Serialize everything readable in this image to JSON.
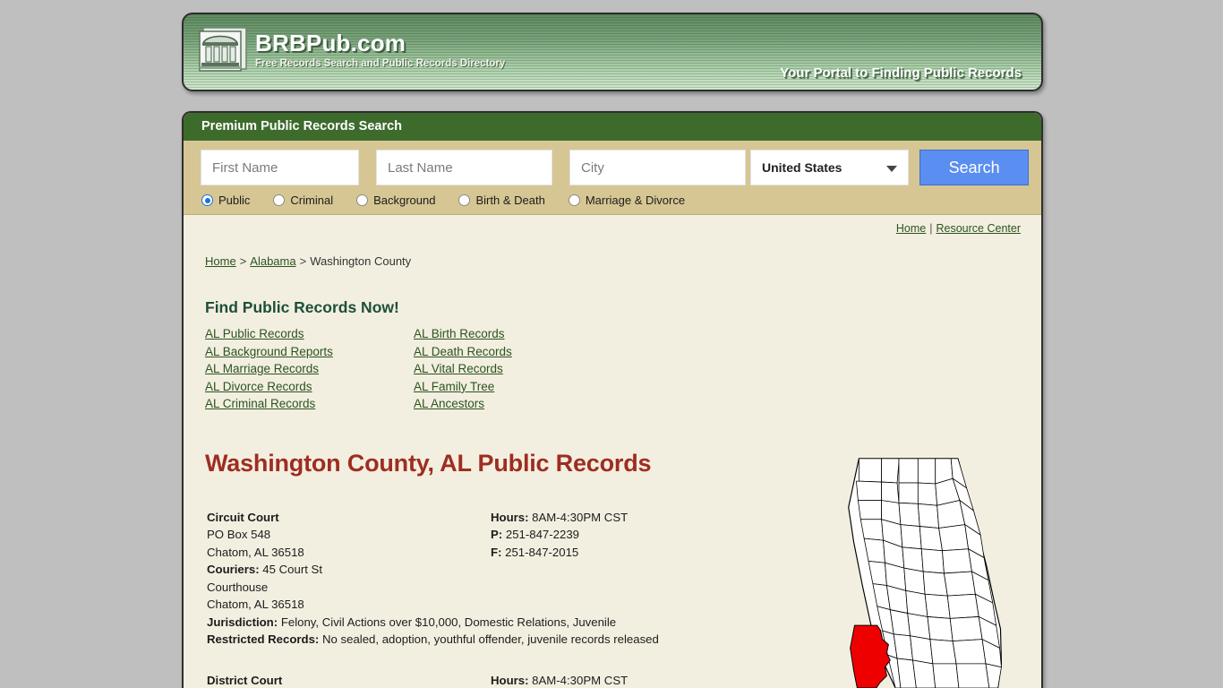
{
  "banner": {
    "logo_icon": "courthouse-icon",
    "title": "BRBPub.com",
    "subtitle": "Free Records Search and Public Records Directory",
    "tagline": "Your Portal to Finding Public Records"
  },
  "search": {
    "panel_title": "Premium Public Records Search",
    "first_name_placeholder": "First Name",
    "first_name_value": "",
    "last_name_placeholder": "Last Name",
    "last_name_value": "",
    "city_placeholder": "City",
    "city_value": "",
    "country_selected": "United States",
    "country_caret_icon": "chevron-down-icon",
    "search_button": "Search",
    "record_types": [
      {
        "label": "Public",
        "selected": true
      },
      {
        "label": "Criminal",
        "selected": false
      },
      {
        "label": "Background",
        "selected": false
      },
      {
        "label": "Birth & Death",
        "selected": false
      },
      {
        "label": "Marriage & Divorce",
        "selected": false
      }
    ]
  },
  "util_nav": {
    "home": "Home",
    "separator": "|",
    "resource_center": "Resource Center"
  },
  "breadcrumb": {
    "home": "Home",
    "sep1": ">",
    "state": "Alabama",
    "sep2": ">",
    "current": "Washington County"
  },
  "find_records": {
    "title": "Find Public Records Now!",
    "column_1": [
      "AL Public Records",
      "AL Background Reports",
      "AL Marriage Records",
      "AL Divorce Records",
      "AL Criminal Records"
    ],
    "column_2": [
      "AL Birth Records",
      "AL Death Records",
      "AL Vital Records",
      "AL Family Tree",
      "AL Ancestors"
    ]
  },
  "page_title": "Washington County, AL Public Records",
  "court": {
    "name": "Circuit Court",
    "address_line1": "PO Box 548",
    "address_line2": "Chatom, AL 36518",
    "couriers_label": "Couriers:",
    "couriers_value": "45 Court St",
    "couriers_line2": "Courthouse",
    "couriers_line3": "Chatom, AL 36518",
    "jurisdiction_label": "Jurisdiction:",
    "jurisdiction_value": "Felony, Civil Actions over $10,000, Domestic Relations, Juvenile",
    "restricted_label": "Restricted Records:",
    "restricted_value": "No sealed, adoption, youthful offender, juvenile records released",
    "hours_label": "Hours:",
    "hours_value": "8AM-4:30PM CST",
    "phone_label": "P:",
    "phone_value": "251-847-2239",
    "fax_label": "F:",
    "fax_value": "251-847-2015"
  },
  "court_next": {
    "name": "District Court",
    "hours_label": "Hours:",
    "hours_value": "8AM-4:30PM CST"
  },
  "map": {
    "state": "Alabama",
    "highlighted_county": "Washington County",
    "highlight_color": "#ee0000",
    "outline_color": "#000000",
    "fill_color": "#ffffff"
  },
  "colors": {
    "banner_green_dark": "#5f8b60",
    "banner_green_light": "#cfe9cc",
    "panel_green": "#3d6b2c",
    "panel_tan": "#d6c693",
    "page_bg": "#f3efe0",
    "link_green": "#2b5320",
    "title_red": "#9e2d21",
    "button_blue": "#5a8ef0",
    "outside_gray": "#bfbfbf"
  }
}
